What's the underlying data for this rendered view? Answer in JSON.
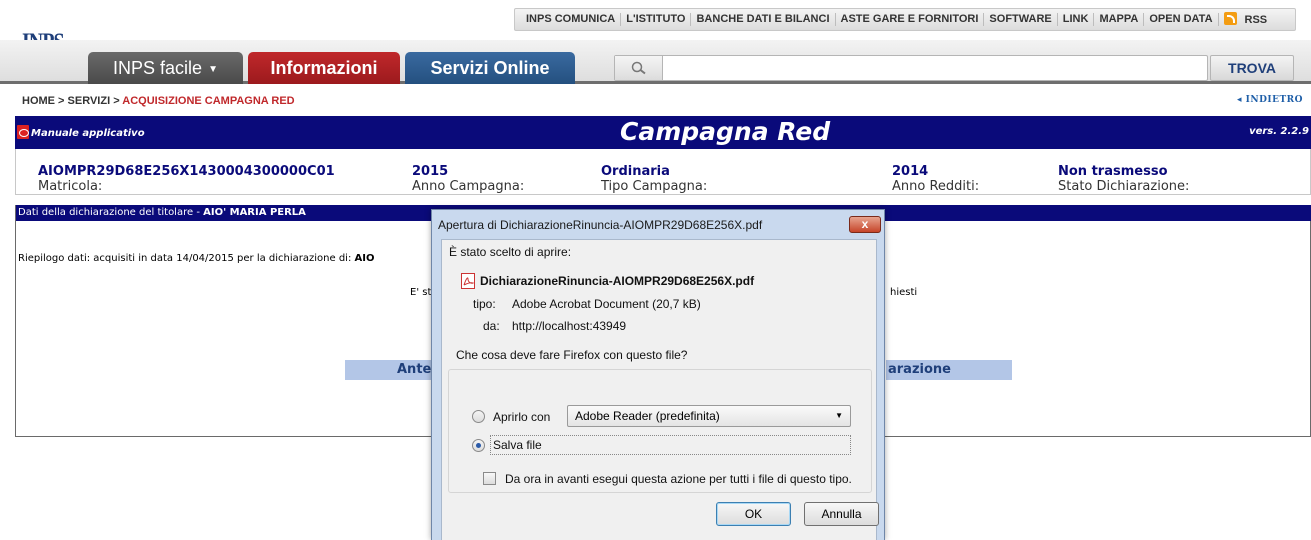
{
  "logo": {
    "text": "INPS"
  },
  "topnav": {
    "items": [
      "INPS COMUNICA",
      "L'ISTITUTO",
      "BANCHE DATI E BILANCI",
      "ASTE GARE E FORNITORI",
      "SOFTWARE",
      "LINK",
      "MAPPA",
      "OPEN DATA"
    ],
    "rss": "RSS"
  },
  "tabs": {
    "facile": "INPS facile",
    "info": "Informazioni",
    "servizi": "Servizi Online"
  },
  "search": {
    "value": "",
    "button": "TROVA"
  },
  "breadcrumb": {
    "home": "HOME",
    "sep1": " > ",
    "servizi": "SERVIZI",
    "sep2": " > ",
    "current": "ACQUISIZIONE CAMPAGNA RED"
  },
  "back": "◂ INDIETRO",
  "banner": {
    "manuale": "Manuale applicativo",
    "title": "Campagna Red",
    "version": "vers. 2.2.9"
  },
  "info": {
    "matricola_label": "Matricola: ",
    "matricola": "AIOMPR29D68E256X1430004300000C01",
    "anno_label": "Anno Campagna: ",
    "anno": "2015",
    "tipo_label": "Tipo Campagna: ",
    "tipo": "Ordinaria",
    "redditi_label": "Anno Redditi: ",
    "redditi": "2014",
    "stato_label": "Stato Dichiarazione: ",
    "stato": "Non trasmesso"
  },
  "panel": {
    "head_prefix": "Dati della dichiarazione del titolare - ",
    "head_name": "AIO' MARIA PERLA",
    "riepilogo": "Riepilogo dati: acquisiti in data 14/04/2015 per la dichiarazione di: ",
    "riepilogo_tail": "AIO",
    "est": "E' st",
    "iesti": "hiesti",
    "antep": "Antep",
    "dich": "arazione"
  },
  "dialog": {
    "title": "Apertura di DichiarazioneRinuncia-AIOMPR29D68E256X.pdf",
    "close": "x",
    "chosen": "È stato scelto di aprire:",
    "filename": "DichiarazioneRinuncia-AIOMPR29D68E256X.pdf",
    "type_label": "tipo:",
    "type": "Adobe Acrobat Document (20,7 kB)",
    "from_label": "da:",
    "from": "http://localhost:43949",
    "question": "Che cosa deve fare Firefox con questo file?",
    "open_with": "Aprirlo con",
    "app": "Adobe Reader  (predefinita)",
    "save": "Salva file",
    "remember": "Da ora in avanti esegui questa azione per tutti i file di questo tipo.",
    "ok": "OK",
    "cancel": "Annulla"
  },
  "colors": {
    "navy": "#0a0a7a",
    "red_tab": "#c0282b",
    "blue_tab": "#24507f",
    "gray_tab": "#4a4a4a",
    "light_blue_btn": "#b3c6e7"
  }
}
